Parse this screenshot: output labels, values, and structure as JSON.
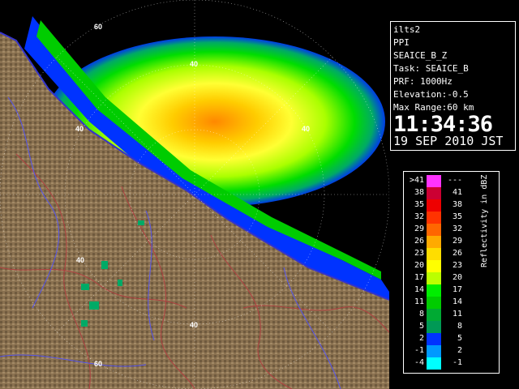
{
  "info": {
    "site": "ilts2",
    "scan_type": "PPI",
    "product": "SEAICE_B_Z",
    "task": "Task: SEAICE_B",
    "prf": "PRF: 1000Hz",
    "elevation": "Elevation:-0.5",
    "max_range": "Max Range:60 km",
    "time": "11:34:36",
    "date": "19 SEP 2010 JST"
  },
  "range_labels": [
    "60",
    "40",
    "40",
    "40",
    "40",
    "40",
    "60"
  ],
  "legend": {
    "title": "Reflectivity in dBZ",
    "rows": [
      {
        "left": ">41",
        "right": "---",
        "color": "#ff33ff"
      },
      {
        "left": "38",
        "right": "41",
        "color": "#cc0033"
      },
      {
        "left": "35",
        "right": "38",
        "color": "#ee0000"
      },
      {
        "left": "32",
        "right": "35",
        "color": "#ff3300"
      },
      {
        "left": "29",
        "right": "32",
        "color": "#ff6600"
      },
      {
        "left": "26",
        "right": "29",
        "color": "#ffaa00"
      },
      {
        "left": "23",
        "right": "26",
        "color": "#ffdd00"
      },
      {
        "left": "20",
        "right": "23",
        "color": "#ffff00"
      },
      {
        "left": "17",
        "right": "20",
        "color": "#bbff00"
      },
      {
        "left": "14",
        "right": "17",
        "color": "#00ee00"
      },
      {
        "left": "11",
        "right": "14",
        "color": "#00cc00"
      },
      {
        "left": "8",
        "right": "11",
        "color": "#00aa33"
      },
      {
        "left": "5",
        "right": "8",
        "color": "#009955"
      },
      {
        "left": "2",
        "right": "5",
        "color": "#0033ff"
      },
      {
        "left": "-1",
        "right": "2",
        "color": "#0099ff"
      },
      {
        "left": "-4",
        "right": "-1",
        "color": "#00ffff"
      }
    ]
  },
  "colors": {
    "land": "#8a7150",
    "sea": "#000000",
    "coast": "#2d2dcc",
    "rivers": "#b04040"
  }
}
